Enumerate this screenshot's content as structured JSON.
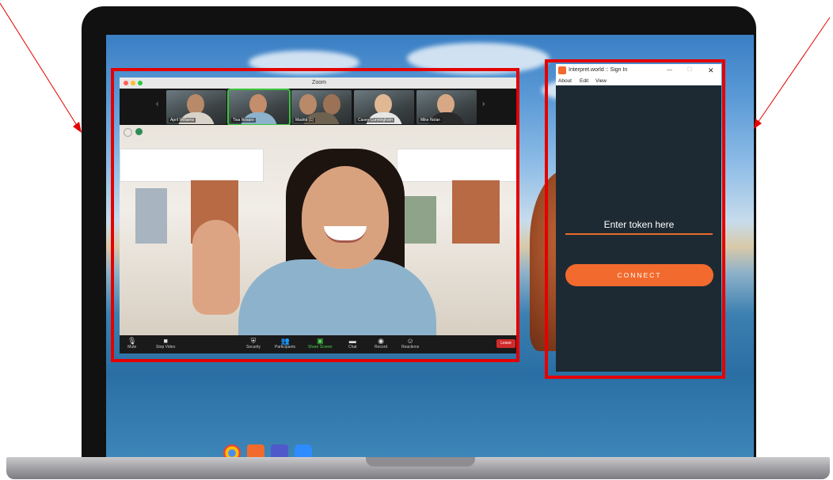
{
  "zoom": {
    "title": "Zoom",
    "participants": [
      {
        "name": "April Williams"
      },
      {
        "name": "Tisa Rosaro"
      },
      {
        "name": "Madrid (1)"
      },
      {
        "name": "Casey Cunningham"
      },
      {
        "name": "Mike Nolan"
      }
    ],
    "toolbar": {
      "mute": "Mute",
      "stop_video": "Stop Video",
      "security": "Security",
      "participants": "Participants",
      "share_screen": "Share Screen",
      "chat": "Chat",
      "record": "Record",
      "reactions": "Reactions",
      "leave": "Leave"
    }
  },
  "interpret": {
    "window_title": "Interpret.world :: Sign In",
    "menu": [
      "About",
      "Edit",
      "View"
    ],
    "token_placeholder": "Enter token here",
    "connect_label": "CONNECT",
    "accent_color": "#f26a2d",
    "background_color": "#1e2a33"
  },
  "taskbar": {
    "icons": [
      "chrome-icon",
      "interpret-app-icon",
      "teams-icon",
      "zoom-icon"
    ]
  },
  "highlight_color": "#e40000"
}
